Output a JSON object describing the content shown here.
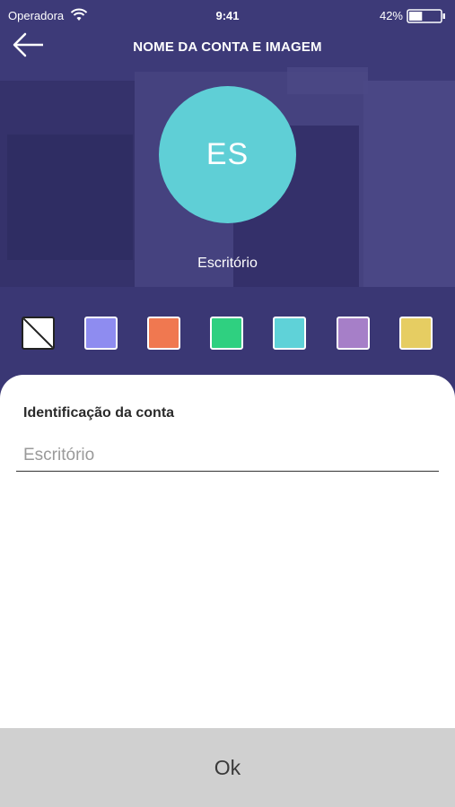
{
  "status_bar": {
    "carrier": "Operadora",
    "time": "9:41",
    "battery_percent": "42%",
    "battery_level": 0.42,
    "icons": [
      "wifi-icon",
      "battery-icon"
    ]
  },
  "header": {
    "back_icon": "arrow-left-icon",
    "title": "NOME DA CONTA E IMAGEM"
  },
  "avatar": {
    "initials": "ES",
    "color": "#5fcfd6"
  },
  "account_name": "Escritório",
  "color_options": [
    {
      "name": "none",
      "color": "#ffffff",
      "selected": true
    },
    {
      "name": "periwinkle",
      "color": "#8e8cf0"
    },
    {
      "name": "orange",
      "color": "#f07850"
    },
    {
      "name": "green",
      "color": "#2fd080"
    },
    {
      "name": "cyan",
      "color": "#5fd2d8"
    },
    {
      "name": "purple",
      "color": "#a67fc8"
    },
    {
      "name": "yellow",
      "color": "#e6cd62"
    }
  ],
  "form": {
    "label": "Identificação da conta",
    "placeholder": "Escritório"
  },
  "ok_button": "Ok",
  "colors": {
    "hero_overlay": "#3f3b7a",
    "ok_background": "#d0d0d0"
  }
}
